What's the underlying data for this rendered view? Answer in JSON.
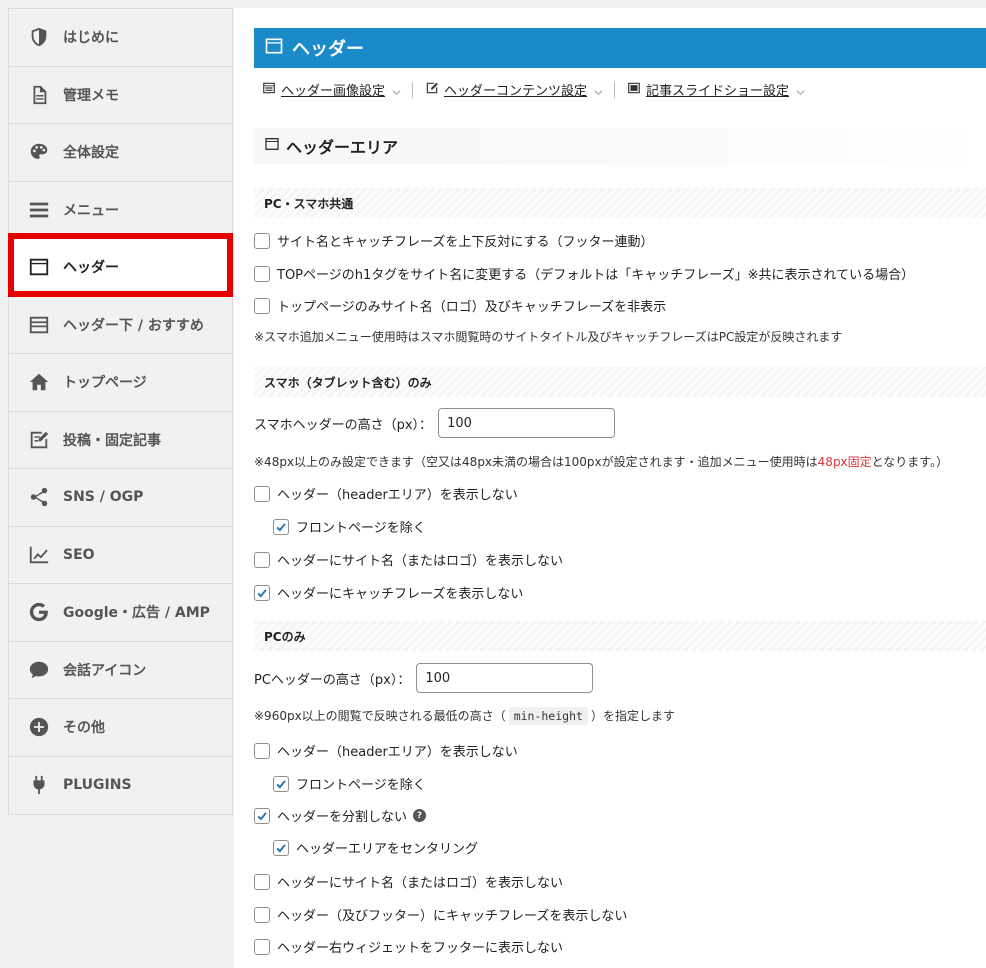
{
  "sidebar": {
    "items": [
      {
        "label": "はじめに",
        "icon": "shield-half-icon"
      },
      {
        "label": "管理メモ",
        "icon": "document-icon"
      },
      {
        "label": "全体設定",
        "icon": "palette-icon"
      },
      {
        "label": "メニュー",
        "icon": "hamburger-menu-icon"
      },
      {
        "label": "ヘッダー",
        "icon": "header-layout-icon",
        "active": true
      },
      {
        "label": "ヘッダー下 / おすすめ",
        "icon": "header-below-layout-icon"
      },
      {
        "label": "トップページ",
        "icon": "home-icon"
      },
      {
        "label": "投稿・固定記事",
        "icon": "edit-post-icon"
      },
      {
        "label": "SNS / OGP",
        "icon": "share-icon"
      },
      {
        "label": "SEO",
        "icon": "line-chart-icon"
      },
      {
        "label": "Google・広告 / AMP",
        "icon": "google-g-icon"
      },
      {
        "label": "会話アイコン",
        "icon": "speech-bubble-icon"
      },
      {
        "label": "その他",
        "icon": "plus-circle-icon"
      },
      {
        "label": "PLUGINS",
        "icon": "plug-icon"
      }
    ],
    "highlight_color": "#e50000"
  },
  "main": {
    "title": "ヘッダー",
    "title_bar_color": "#1a8ac8",
    "subnav": [
      {
        "label": "ヘッダー画像設定",
        "icon": "header-image-icon"
      },
      {
        "label": "ヘッダーコンテンツ設定",
        "icon": "edit-box-icon"
      },
      {
        "label": "記事スライドショー設定",
        "icon": "slideshow-icon"
      }
    ],
    "area_heading": "ヘッダーエリア",
    "sections": {
      "common": {
        "title": "PC・スマホ共通",
        "options": [
          {
            "label": "サイト名とキャッチフレーズを上下反対にする（フッター連動）",
            "checked": false
          },
          {
            "label": "TOPページのh1タグをサイト名に変更する（デフォルトは「キャッチフレーズ」※共に表示されている場合）",
            "checked": false
          },
          {
            "label": "トップページのみサイト名（ロゴ）及びキャッチフレーズを非表示",
            "checked": false
          }
        ],
        "note": "※スマホ追加メニュー使用時はスマホ閲覧時のサイトタイトル及びキャッチフレーズはPC設定が反映されます"
      },
      "smartphone": {
        "title": "スマホ（タブレット含む）のみ",
        "height_label": "スマホヘッダーの高さ（px）：",
        "height_value": "100",
        "note_pre": "※48px以上のみ設定できます（空又は48px未満の場合は100pxが設定されます・追加メニュー使用時は",
        "note_red": "48px固定",
        "note_post": "となります。）",
        "options": [
          {
            "label": "ヘッダー（headerエリア）を表示しない",
            "checked": false
          },
          {
            "label": "フロントページを除く",
            "checked": true
          },
          {
            "label": "ヘッダーにサイト名（またはロゴ）を表示しない",
            "checked": false
          },
          {
            "label": "ヘッダーにキャッチフレーズを表示しない",
            "checked": true
          }
        ]
      },
      "pc": {
        "title": "PCのみ",
        "height_label": "PCヘッダーの高さ（px）：",
        "height_value": "100",
        "note_pre": "※960px以上の閲覧で反映される最低の高さ（",
        "note_code": "min-height",
        "note_post": "）を指定します",
        "options": [
          {
            "label": "ヘッダー（headerエリア）を表示しない",
            "checked": false
          },
          {
            "label": "フロントページを除く",
            "checked": true
          },
          {
            "label": "ヘッダーを分割しない",
            "checked": true,
            "help": "?"
          },
          {
            "label": "ヘッダーエリアをセンタリング",
            "checked": true
          },
          {
            "label": "ヘッダーにサイト名（またはロゴ）を表示しない",
            "checked": false
          },
          {
            "label": "ヘッダー（及びフッター）にキャッチフレーズを表示しない",
            "checked": false
          },
          {
            "label": "ヘッダー右ウィジェットをフッターに表示しない",
            "checked": false
          }
        ]
      }
    }
  }
}
